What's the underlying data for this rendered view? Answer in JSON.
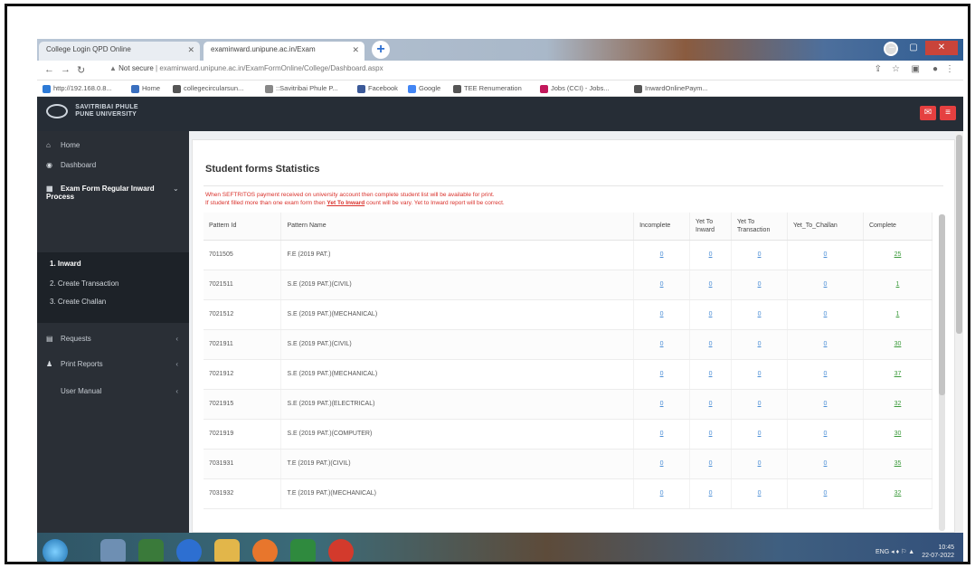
{
  "browser": {
    "tabs": [
      {
        "label": "College Login QPD Online",
        "active": false
      },
      {
        "label": "examinward.unipune.ac.in/Exam",
        "active": true
      }
    ],
    "url_prefix": "Not secure",
    "url": "examinward.unipune.ac.in/ExamFormOnline/College/Dashboard.aspx",
    "bookmarks": [
      {
        "label": "http://192.168.0.8...",
        "color": "#2d7ad6"
      },
      {
        "label": "Home",
        "color": "#3a6fbf"
      },
      {
        "label": "collegecircularsun...",
        "color": "#555555"
      },
      {
        "label": "::Savitribai Phule P...",
        "color": "#888888"
      },
      {
        "label": "Facebook",
        "color": "#3b5998"
      },
      {
        "label": "Google",
        "color": "#4285f4"
      },
      {
        "label": "TEE Renumeration",
        "color": "#555555"
      },
      {
        "label": "Jobs (CCI) - Jobs...",
        "color": "#c2185b"
      },
      {
        "label": "InwardOnlinePaym...",
        "color": "#555555"
      }
    ]
  },
  "app": {
    "brand_line1": "SAVITRIBAI PHULE",
    "brand_line2": "PUNE UNIVERSITY",
    "accent_color": "#e54040"
  },
  "sidebar": {
    "items": [
      {
        "label": "Home",
        "icon": "home-icon"
      },
      {
        "label": "Dashboard",
        "icon": "dashboard-icon"
      },
      {
        "label": "Exam Form Regular Inward Process",
        "icon": "grid-icon"
      },
      {
        "label": "Requests",
        "icon": "list-icon"
      },
      {
        "label": "Print Reports",
        "icon": "user-icon"
      },
      {
        "label": "User Manual",
        "icon": ""
      }
    ],
    "subitems": [
      "1. Inward",
      "2. Create Transaction",
      "3. Create Challan"
    ]
  },
  "main": {
    "title": "Student forms Statistics",
    "notice_line1": "When SEFTRITOS payment received on university account then complete student list will be available for print.",
    "notice_line2_pre": "If student filled more than one exam form then",
    "notice_link": "Yet To Inward",
    "notice_line2_post": "count will be vary. Yet to Inward report will be correct.",
    "table": {
      "columns": [
        "Pattern Id",
        "Pattern Name",
        "Incomplete",
        "Yet To Inward",
        "Yet To Transaction",
        "Yet_To_Challan",
        "Complete"
      ],
      "rows": [
        [
          "7011505",
          "F.E (2019 PAT.)",
          "0",
          "0",
          "0",
          "0",
          "25"
        ],
        [
          "7021511",
          "S.E (2019 PAT.)(CIVIL)",
          "0",
          "0",
          "0",
          "0",
          "1"
        ],
        [
          "7021512",
          "S.E (2019 PAT.)(MECHANICAL)",
          "0",
          "0",
          "0",
          "0",
          "1"
        ],
        [
          "7021911",
          "S.E (2019 PAT.)(CIVIL)",
          "0",
          "0",
          "0",
          "0",
          "30"
        ],
        [
          "7021912",
          "S.E (2019 PAT.)(MECHANICAL)",
          "0",
          "0",
          "0",
          "0",
          "37"
        ],
        [
          "7021915",
          "S.E (2019 PAT.)(ELECTRICAL)",
          "0",
          "0",
          "0",
          "0",
          "32"
        ],
        [
          "7021919",
          "S.E (2019 PAT.)(COMPUTER)",
          "0",
          "0",
          "0",
          "0",
          "30"
        ],
        [
          "7031931",
          "T.E (2019 PAT.)(CIVIL)",
          "0",
          "0",
          "0",
          "0",
          "35"
        ],
        [
          "7031932",
          "T.E (2019 PAT.)(MECHANICAL)",
          "0",
          "0",
          "0",
          "0",
          "32"
        ]
      ]
    }
  },
  "taskbar": {
    "time": "10:45",
    "date": "22-07-2022",
    "lang": "ENG"
  }
}
